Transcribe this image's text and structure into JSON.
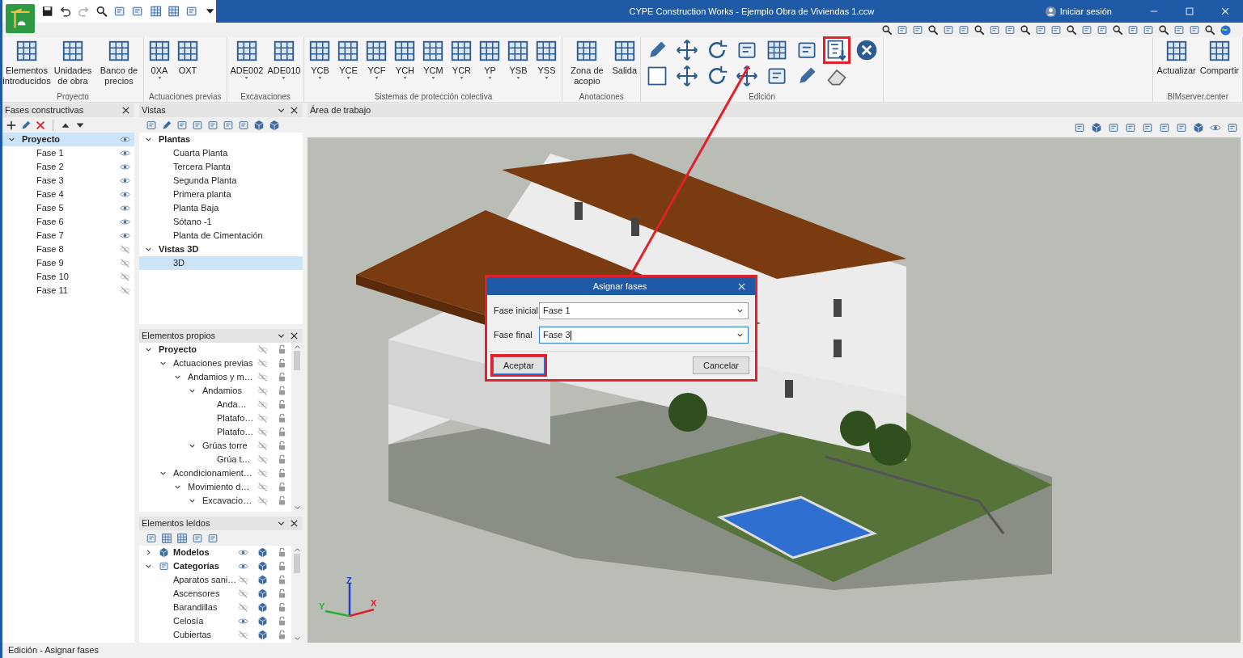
{
  "window": {
    "title": "CYPE Construction Works - Ejemplo Obra de Viviendas 1.ccw",
    "sign_in": "Iniciar sesión"
  },
  "ribbon": [
    {
      "kind": "buttons",
      "label": "Proyecto",
      "buttons": [
        {
          "label": "Elementos introducidos",
          "dropdown": false
        },
        {
          "label": "Unidades de obra",
          "dropdown": false
        },
        {
          "label": "Banco de precios",
          "dropdown": false
        }
      ]
    },
    {
      "kind": "buttons",
      "label": "Actuaciones previas",
      "buttons": [
        {
          "label": "0XA",
          "dropdown": true
        },
        {
          "label": "OXT",
          "dropdown": false
        }
      ]
    },
    {
      "kind": "buttons",
      "label": "Excavaciones",
      "buttons": [
        {
          "label": "ADE002",
          "dropdown": true
        },
        {
          "label": "ADE010",
          "dropdown": true
        }
      ]
    },
    {
      "kind": "buttons",
      "label": "Sistemas de protección colectiva",
      "buttons": [
        {
          "label": "YCB",
          "dropdown": true
        },
        {
          "label": "YCE",
          "dropdown": true
        },
        {
          "label": "YCF",
          "dropdown": true
        },
        {
          "label": "YCH",
          "dropdown": true
        },
        {
          "label": "YCM",
          "dropdown": true
        },
        {
          "label": "YCR",
          "dropdown": true
        },
        {
          "label": "YP",
          "dropdown": true
        },
        {
          "label": "YSB",
          "dropdown": true
        },
        {
          "label": "YSS",
          "dropdown": true
        }
      ]
    },
    {
      "kind": "buttons",
      "label": "Anotaciones",
      "buttons": [
        {
          "label": "Zona de acopio",
          "dropdown": false
        },
        {
          "label": "Salida",
          "dropdown": false
        }
      ]
    },
    {
      "kind": "tools",
      "label": "Edición"
    },
    {
      "kind": "buttons",
      "label": "BIMserver.center",
      "buttons": [
        {
          "label": "Actualizar",
          "dropdown": false
        },
        {
          "label": "Compartir",
          "dropdown": false
        }
      ]
    }
  ],
  "phases": {
    "title": "Fases constructivas",
    "tree": [
      {
        "label": "Proyecto",
        "selected": true,
        "expanded": true,
        "visible": true,
        "children": [
          {
            "label": "Fase 1",
            "selected": false,
            "visible": true
          },
          {
            "label": "Fase 2",
            "selected": false,
            "visible": true
          },
          {
            "label": "Fase 3",
            "selected": false,
            "visible": true
          },
          {
            "label": "Fase 4",
            "selected": false,
            "visible": true
          },
          {
            "label": "Fase 5",
            "selected": false,
            "visible": true
          },
          {
            "label": "Fase 6",
            "selected": false,
            "visible": true
          },
          {
            "label": "Fase 7",
            "selected": false,
            "visible": true
          },
          {
            "label": "Fase 8",
            "selected": false,
            "visible": false
          },
          {
            "label": "Fase 9",
            "selected": false,
            "visible": false
          },
          {
            "label": "Fase 10",
            "selected": false,
            "visible": false
          },
          {
            "label": "Fase 11",
            "selected": false,
            "visible": false
          }
        ]
      }
    ]
  },
  "views": {
    "title": "Vistas",
    "tree": [
      {
        "label": "Plantas",
        "selected": false,
        "expanded": true,
        "children": [
          {
            "label": "Cuarta Planta",
            "selected": false
          },
          {
            "label": "Tercera Planta",
            "selected": false
          },
          {
            "label": "Segunda Planta",
            "selected": false
          },
          {
            "label": "Primera planta",
            "selected": false
          },
          {
            "label": "Planta Baja",
            "selected": false
          },
          {
            "label": "Sótano -1",
            "selected": false
          },
          {
            "label": "Planta de Cimentación",
            "selected": false
          }
        ]
      },
      {
        "label": "Vistas 3D",
        "selected": false,
        "expanded": true,
        "children": [
          {
            "label": "3D",
            "selected": true
          }
        ]
      }
    ]
  },
  "own_elements": {
    "title": "Elementos propios",
    "tree": [
      {
        "label": "Proyecto",
        "expanded": true,
        "visible": false,
        "children": [
          {
            "label": "Actuaciones previas",
            "expanded": true,
            "visible": false,
            "children": [
              {
                "label": "Andamios y m…",
                "expanded": true,
                "visible": false,
                "children": [
                  {
                    "label": "Andamios",
                    "expanded": true,
                    "visible": false,
                    "children": [
                      {
                        "label": "Anda…",
                        "visible": false
                      },
                      {
                        "label": "Platafo…",
                        "visible": false
                      },
                      {
                        "label": "Platafo…",
                        "visible": false
                      }
                    ]
                  },
                  {
                    "label": "Grúas torre",
                    "expanded": true,
                    "visible": false,
                    "children": [
                      {
                        "label": "Grúa t…",
                        "visible": false
                      }
                    ]
                  }
                ]
              }
            ]
          },
          {
            "label": "Acondicionamient…",
            "expanded": true,
            "visible": false,
            "children": [
              {
                "label": "Movimiento d…",
                "expanded": true,
                "visible": false,
                "children": [
                  {
                    "label": "Excavacio…",
                    "expanded": true,
                    "visible": false
                  }
                ]
              }
            ]
          }
        ]
      }
    ]
  },
  "read_elements": {
    "title": "Elementos leídos",
    "tree": [
      {
        "kind": "models",
        "label": "Modelos",
        "expanded": false,
        "visible": true
      },
      {
        "kind": "categories",
        "label": "Categorías",
        "expanded": true,
        "visible": true,
        "children": [
          {
            "label": "Aparatos sani…",
            "visible": false
          },
          {
            "label": "Ascensores",
            "visible": false
          },
          {
            "label": "Barandillas",
            "visible": false
          },
          {
            "label": "Celosía",
            "visible": true
          },
          {
            "label": "Cubiertas",
            "visible": false
          }
        ]
      }
    ]
  },
  "workspace": {
    "title": "Área de trabajo",
    "axis_labels": [
      "Z",
      "Y",
      "X"
    ]
  },
  "dialog": {
    "title": "Asignar fases",
    "fields": [
      {
        "label": "Fase inicial",
        "value": "Fase 1",
        "focused": false
      },
      {
        "label": "Fase final",
        "value": "Fase 3",
        "focused": true
      }
    ],
    "buttons": [
      {
        "label": "Aceptar",
        "default": true
      },
      {
        "label": "Cancelar",
        "default": false
      }
    ]
  },
  "status_bar": "Edición - Asignar fases"
}
